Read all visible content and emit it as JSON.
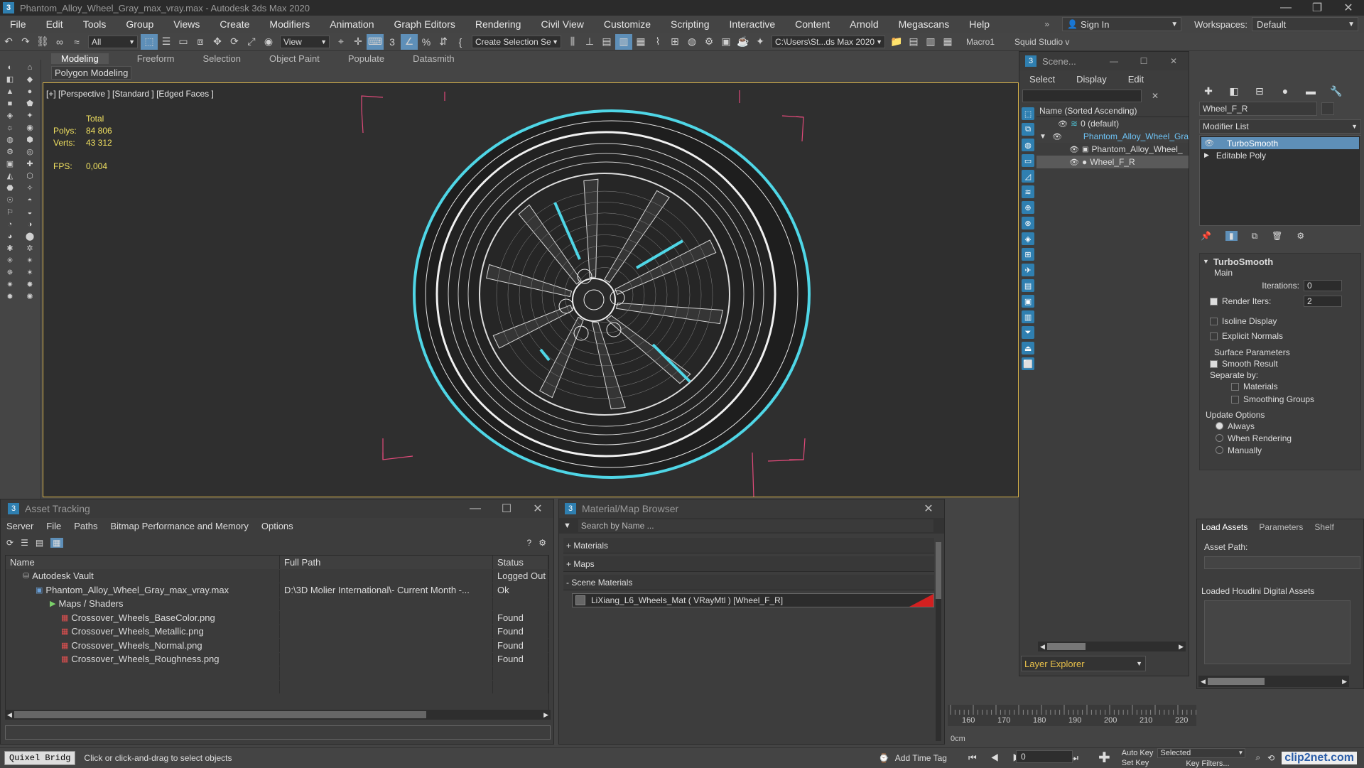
{
  "window": {
    "title": "Phantom_Alloy_Wheel_Gray_max_vray.max - Autodesk 3ds Max 2020"
  },
  "menu": {
    "items": [
      "File",
      "Edit",
      "Tools",
      "Group",
      "Views",
      "Create",
      "Modifiers",
      "Animation",
      "Graph Editors",
      "Rendering",
      "Civil View",
      "Customize",
      "Scripting",
      "Interactive",
      "Content",
      "Arnold",
      "Megascans",
      "Help"
    ],
    "sign_in": "Sign In",
    "workspaces_label": "Workspaces:",
    "workspaces_value": "Default"
  },
  "toolbar": {
    "filter": "All",
    "view": "View",
    "selection_set": "Create Selection Se",
    "path": "C:\\Users\\St...ds Max 2020",
    "macro": "Macro1",
    "squid": "Squid Studio v"
  },
  "ribbon": {
    "tabs": [
      "Modeling",
      "Freeform",
      "Selection",
      "Object Paint",
      "Populate",
      "Datasmith"
    ],
    "sub": "Polygon Modeling"
  },
  "viewport": {
    "label": "[+] [Perspective ] [Standard ] [Edged Faces ]",
    "stats": {
      "total": "Total",
      "polys_label": "Polys:",
      "polys": "84 806",
      "verts_label": "Verts:",
      "verts": "43 312",
      "fps_label": "FPS:",
      "fps": "0,004"
    }
  },
  "scene_explorer": {
    "title": "Scene...",
    "menu": [
      "Select",
      "Display",
      "Edit"
    ],
    "column": "Name (Sorted Ascending)",
    "items": [
      "0 (default)",
      "Phantom_Alloy_Wheel_Gra",
      "Phantom_Alloy_Wheel_",
      "Wheel_F_R"
    ],
    "layer": "Layer Explorer"
  },
  "command_panel": {
    "object_name": "Wheel_F_R",
    "modifier_list": "Modifier List",
    "stack": [
      "TurboSmooth",
      "Editable Poly"
    ],
    "rollout": "TurboSmooth",
    "main": "Main",
    "iterations_label": "Iterations:",
    "iterations": "0",
    "render_iters_label": "Render Iters:",
    "render_iters": "2",
    "isoline": "Isoline Display",
    "explicit": "Explicit Normals",
    "surface": "Surface Parameters",
    "smooth_result": "Smooth Result",
    "separate_by": "Separate by:",
    "materials": "Materials",
    "smoothing_groups": "Smoothing Groups",
    "update_options": "Update Options",
    "always": "Always",
    "when_rendering": "When Rendering",
    "manually": "Manually"
  },
  "houdini": {
    "tabs": [
      "Load Assets",
      "Parameters",
      "Shelf"
    ],
    "asset_path": "Asset Path:",
    "loaded": "Loaded Houdini Digital Assets"
  },
  "asset_tracking": {
    "title": "Asset Tracking",
    "menu": [
      "Server",
      "File",
      "Paths",
      "Bitmap Performance and Memory",
      "Options"
    ],
    "columns": [
      "Name",
      "Full Path",
      "Status"
    ],
    "rows": [
      {
        "name": "Autodesk Vault",
        "path": "",
        "status": "Logged Out ."
      },
      {
        "name": "Phantom_Alloy_Wheel_Gray_max_vray.max",
        "path": "D:\\3D Molier International\\- Current Month -...",
        "status": "Ok"
      },
      {
        "name": "Maps / Shaders",
        "path": "",
        "status": ""
      },
      {
        "name": "Crossover_Wheels_BaseColor.png",
        "path": "",
        "status": "Found"
      },
      {
        "name": "Crossover_Wheels_Metallic.png",
        "path": "",
        "status": "Found"
      },
      {
        "name": "Crossover_Wheels_Normal.png",
        "path": "",
        "status": "Found"
      },
      {
        "name": "Crossover_Wheels_Roughness.png",
        "path": "",
        "status": "Found"
      }
    ]
  },
  "material_browser": {
    "title": "Material/Map Browser",
    "search": "Search by Name ...",
    "groups": [
      "+ Materials",
      "+ Maps",
      "- Scene Materials"
    ],
    "material": "LiXiang_L6_Wheels_Mat  ( VRayMtl ) [Wheel_F_R]"
  },
  "timeline": {
    "ticks": [
      "160",
      "170",
      "180",
      "190",
      "200",
      "210",
      "220"
    ],
    "unit": "0cm"
  },
  "status": {
    "quixel": "Quixel Bridg",
    "prompt": "Click or click-and-drag to select objects",
    "add_time_tag": "Add Time Tag",
    "auto_key": "Auto Key",
    "set_key": "Set Key",
    "selected": "Selected",
    "key_filters": "Key Filters...",
    "frame": "0"
  },
  "watermark": "clip2net.com"
}
